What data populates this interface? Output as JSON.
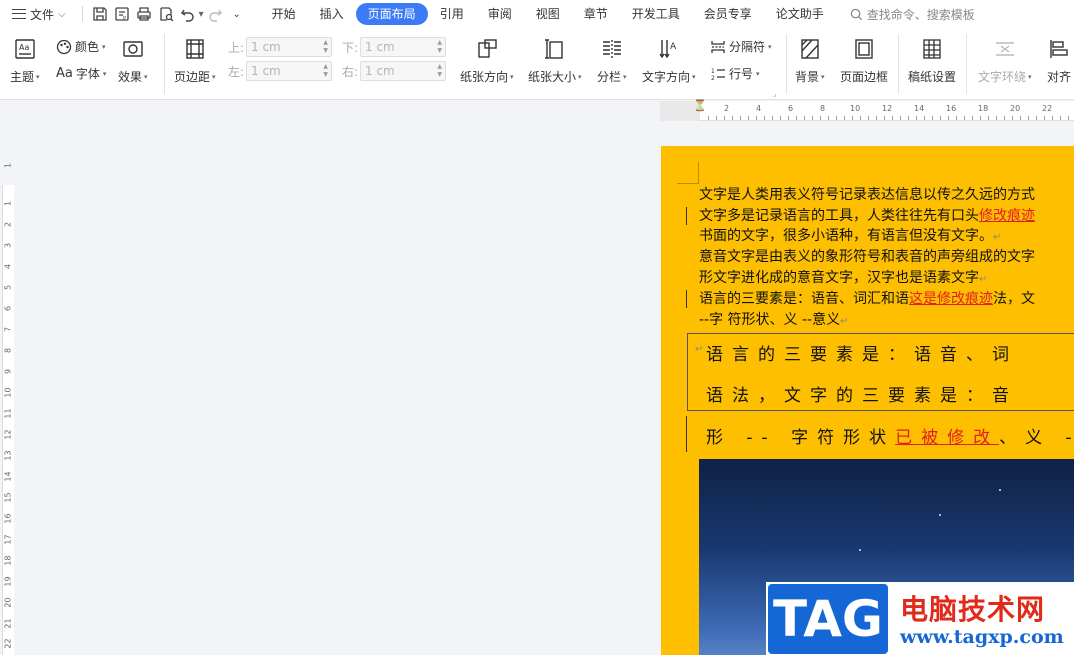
{
  "menu": {
    "file_label": "文件",
    "tabs": [
      {
        "label": "开始",
        "active": false
      },
      {
        "label": "插入",
        "active": false
      },
      {
        "label": "页面布局",
        "active": true
      },
      {
        "label": "引用",
        "active": false
      },
      {
        "label": "审阅",
        "active": false
      },
      {
        "label": "视图",
        "active": false
      },
      {
        "label": "章节",
        "active": false
      },
      {
        "label": "开发工具",
        "active": false
      },
      {
        "label": "会员专享",
        "active": false
      },
      {
        "label": "论文助手",
        "active": false
      }
    ],
    "search_placeholder": "查找命令、搜索模板",
    "accent": "#3b7cf6"
  },
  "ribbon": {
    "theme": "主题",
    "colors": "颜色",
    "font": "字体",
    "effects": "效果",
    "margins": "页边距",
    "top_label": "上:",
    "top_value": "1 cm",
    "bottom_label": "下:",
    "bottom_value": "1 cm",
    "left_label": "左:",
    "left_value": "1 cm",
    "right_label": "右:",
    "right_value": "1 cm",
    "orientation": "纸张方向",
    "size": "纸张大小",
    "columns": "分栏",
    "text_direction": "文字方向",
    "breaks": "分隔符",
    "line_numbers": "行号",
    "background": "背景",
    "page_border": "页面边框",
    "manuscript": "稿纸设置",
    "wrap_text": "文字环绕",
    "align": "对齐"
  },
  "ruler": {
    "h_numbers": [
      "2",
      "4",
      "6",
      "8",
      "10",
      "12",
      "14",
      "16",
      "18",
      "20",
      "22"
    ],
    "v_numbers": [
      "1",
      "1",
      "2",
      "3",
      "4",
      "5",
      "6",
      "7",
      "8",
      "9",
      "10",
      "11",
      "12",
      "13",
      "14",
      "15",
      "16",
      "17",
      "18",
      "19",
      "20",
      "21",
      "22"
    ]
  },
  "document": {
    "page_color": "#fdbf00",
    "lines": [
      {
        "pre": "文字是人类用表义符号记录表达信息以传之久远的方式",
        "rev": "",
        "post": ""
      },
      {
        "pre": "文字多是记录语言的工具，人类往往先有口头",
        "rev": "修改痕迹",
        "post": ""
      },
      {
        "pre": "书面的文字，很多小语种，有语言但没有文字。",
        "rev": "",
        "post": "↵"
      },
      {
        "pre": "意音文字是由表义的象形符号和表音的声旁组成的文字",
        "rev": "",
        "post": ""
      },
      {
        "pre": "形文字进化成的意音文字，汉字也是语素文字",
        "rev": "",
        "post": "↵"
      },
      {
        "pre": "语言的三要素是：语音、词汇和语",
        "rev": "这是修改痕迹",
        "post": "法，文"
      },
      {
        "pre": " --字  符形状、义 --意义",
        "rev": "",
        "post": "↵"
      }
    ],
    "spaced_line1": "语言的三要素是：语音、词",
    "spaced_line2": "语法，文字的三要素是：音",
    "spaced_line3_pre": "形 -- 字符形状",
    "spaced_line3_rev": "已被修改",
    "spaced_line3_post": "、义 -",
    "revision_color": "#e02020"
  },
  "watermark": {
    "tag": "TAG",
    "cn": "电脑技术网",
    "url": "www.tagxp.com"
  }
}
